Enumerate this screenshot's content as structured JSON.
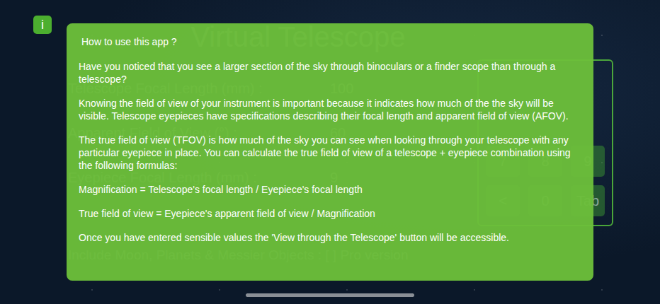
{
  "info_button": {
    "label": "i"
  },
  "background": {
    "title": "Virtual Telescope",
    "fields": [
      {
        "label": "Telescope Focal Length (mm) :",
        "value": "100"
      },
      {
        "label": "Apparent Field of View (°) :",
        "value": "60"
      },
      {
        "label": "Eyepiece Focal Length (mm) :",
        "value": "9"
      }
    ],
    "keypad": [
      "7",
      "8",
      "9",
      "<",
      "0",
      "Tab"
    ],
    "pro_option": {
      "label": "Include Moon, Planets & Messier Objects : [ ] Pro version"
    }
  },
  "dialog": {
    "title": "How to use this app ?",
    "paragraphs": [
      "Have you noticed that you see a larger section of the sky through binoculars or a finder scope than through a telescope?",
      "Knowing the field of view of your instrument is important because it indicates how much of the the sky will be visible. Telescope eyepieces have specifications describing their focal length and apparent field of view (AFOV).",
      "The true field of view (TFOV) is how much of the sky you can see when looking through your telescope with any particular eyepiece in place. You can calculate the true field of view of a telescope + eyepiece combination using the following formulas:",
      "Magnification = Telescope's focal length / Eyepiece's focal length",
      "True field of view = Eyepiece's apparent field of view / Magnification",
      "Once you have entered sensible values the 'View through the Telescope' button will be accessible."
    ]
  }
}
